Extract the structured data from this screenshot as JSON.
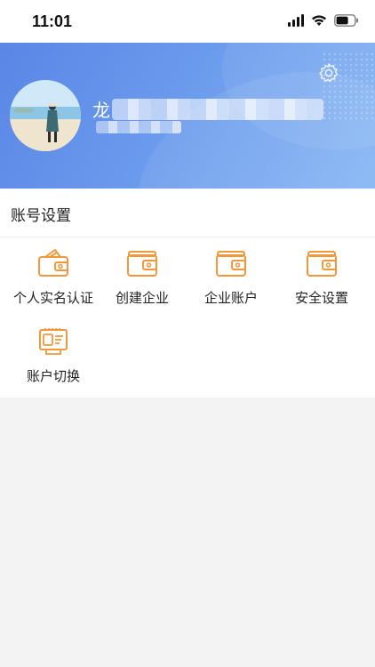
{
  "status_bar": {
    "time": "11:01",
    "icons": [
      "cellular-signal-icon",
      "wifi-icon",
      "battery-icon"
    ]
  },
  "profile": {
    "name_visible": "龙",
    "avatar": "avatar-photo",
    "settings_icon": "gear-icon",
    "colors": {
      "banner_start": "#5a86e6",
      "banner_end": "#86b6f4"
    }
  },
  "account_section": {
    "title": "账号设置",
    "items": [
      {
        "label": "个人实名认证",
        "icon": "id-wallet-icon"
      },
      {
        "label": "创建企业",
        "icon": "wallet-icon"
      },
      {
        "label": "企业账户",
        "icon": "wallet-icon"
      },
      {
        "label": "安全设置",
        "icon": "wallet-icon"
      },
      {
        "label": "账户切换",
        "icon": "id-card-icon"
      }
    ]
  },
  "theme": {
    "accent": "#f0983a",
    "background": "#f3f3f4"
  }
}
